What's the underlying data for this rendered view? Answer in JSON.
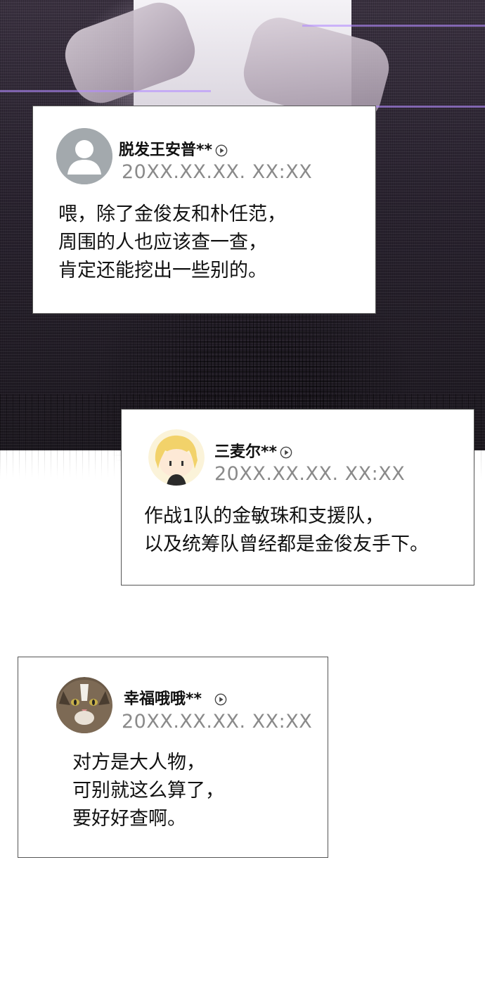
{
  "comments": [
    {
      "username": "脱发王安普**",
      "timestamp": "20XX.XX.XX. XX:XX",
      "lines": [
        "喂，除了金俊友和朴任范，",
        "周围的人也应该查一查，",
        "肯定还能挖出一些别的。"
      ],
      "avatar": "default-person-icon"
    },
    {
      "username": "三麦尔**",
      "timestamp": "20XX.XX.XX. XX:XX",
      "lines": [
        "作战1队的金敏珠和支援队，",
        "以及统筹队曾经都是金俊友手下。"
      ],
      "avatar": "blonde-character-icon"
    },
    {
      "username": "幸福哦哦**",
      "timestamp": "20XX.XX.XX. XX:XX",
      "lines": [
        "对方是大人物，",
        "可别就这么算了，",
        "要好好查啊。"
      ],
      "avatar": "cat-photo-icon"
    }
  ]
}
